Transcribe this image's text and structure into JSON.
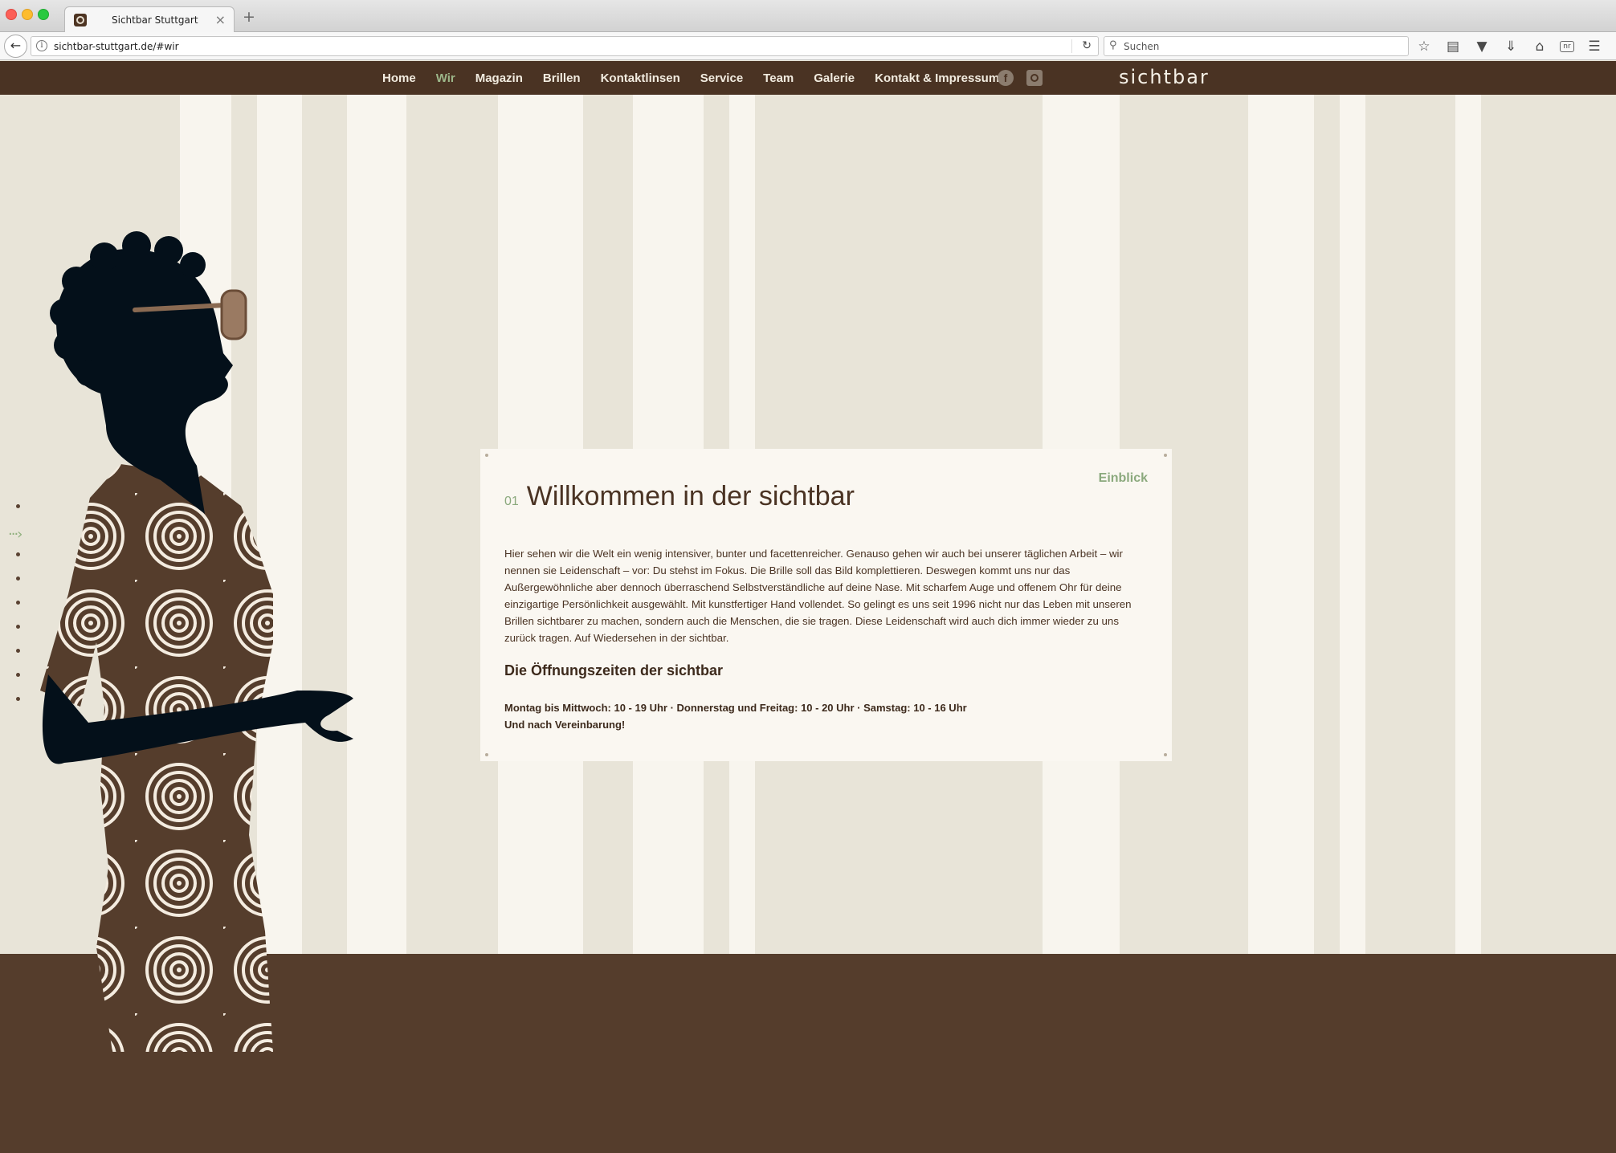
{
  "browser": {
    "tab_title": "Sichtbar Stuttgart",
    "tab_close": "×",
    "new_tab": "+",
    "url": "sichtbar-stuttgart.de/#wir",
    "search_placeholder": "Suchen",
    "icons": [
      "back-icon",
      "info-icon",
      "reload-icon",
      "search-icon",
      "bookmark-star-icon",
      "reading-list-icon",
      "pocket-icon",
      "download-icon",
      "home-icon",
      "reader-icon",
      "menu-icon"
    ]
  },
  "nav": {
    "items": [
      "Home",
      "Wir",
      "Magazin",
      "Brillen",
      "Kontaktlinsen",
      "Service",
      "Team",
      "Galerie",
      "Kontakt & Impressum"
    ],
    "active": "Wir",
    "logo": "sichtbar",
    "social": {
      "facebook": "f"
    }
  },
  "card": {
    "kicker": "Einblick",
    "number": "01",
    "title": "Willkommen in der sichtbar",
    "body": "Hier sehen wir die Welt ein wenig intensiver, bunter und facettenreicher. Genauso gehen wir auch bei unserer täglichen Arbeit – wir nennen sie Leidenschaft – vor: Du stehst im Fokus. Die Brille soll das Bild komplettieren. Deswegen kommt uns nur das Außergewöhnliche aber dennoch überraschend Selbstverständliche auf deine Nase. Mit scharfem Auge und offenem Ohr für deine einzigartige Persönlichkeit ausgewählt. Mit kunstfertiger Hand vollendet. So gelingt es uns seit 1996 nicht nur das Leben mit unseren Brillen sichtbarer zu machen, sondern auch die Menschen, die sie tragen. Diese Leidenschaft wird auch dich immer wieder zu uns zurück tragen. Auf Wiedersehen in der sichtbar.",
    "hours_title": "Die Öffnungszeiten der sichtbar",
    "hours_line1": "Montag bis Mittwoch: 10 - 19 Uhr · Donnerstag und Freitag: 10 - 20 Uhr · Samstag: 10 - 16 Uhr",
    "hours_line2": "Und nach Vereinbarung!"
  },
  "colors": {
    "nav_bg": "#4a3323",
    "accent_green": "#8ba97d",
    "stripe_light": "#f8f5ee",
    "stripe_dark": "#e8e4d8",
    "ground": "#553d2c"
  }
}
